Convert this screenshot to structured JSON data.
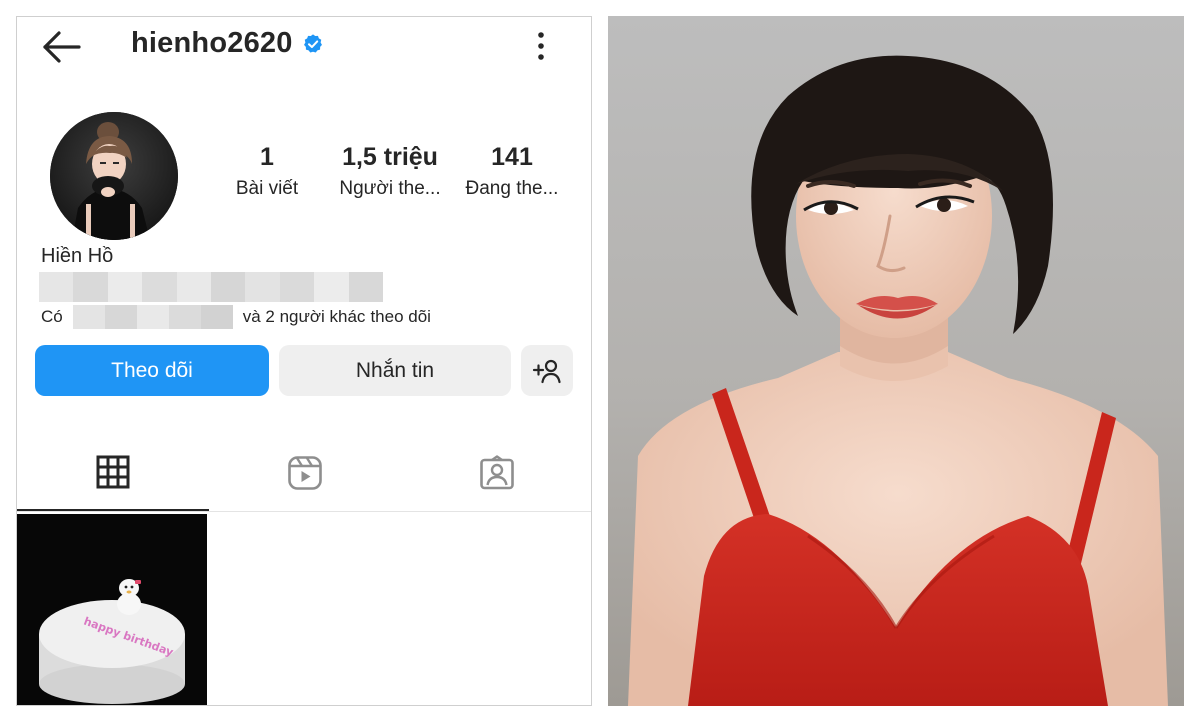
{
  "profile": {
    "username": "hienho2620",
    "display_name": "Hiền Hồ",
    "stats": [
      {
        "value": "1",
        "label": "Bài viết"
      },
      {
        "value": "1,5 triệu",
        "label": "Người the..."
      },
      {
        "value": "141",
        "label": "Đang the..."
      }
    ],
    "followed_by": {
      "prefix": "Có",
      "bold": "và 2 người khác",
      "suffix": "theo dõi"
    }
  },
  "actions": {
    "follow_label": "Theo dõi",
    "message_label": "Nhắn tin"
  },
  "post": {
    "cake_text": "happy birthday"
  },
  "icons": {
    "back": "arrow-left-icon",
    "verified": "verified-badge-icon",
    "more": "more-vertical-icon",
    "add_user": "add-user-icon",
    "grid": "grid-icon",
    "reels": "reels-icon",
    "tagged": "tagged-icon"
  },
  "colors": {
    "accent": "#1f95f5",
    "button_secondary": "#efefef",
    "text": "#262626",
    "dress": "#c8231c"
  }
}
